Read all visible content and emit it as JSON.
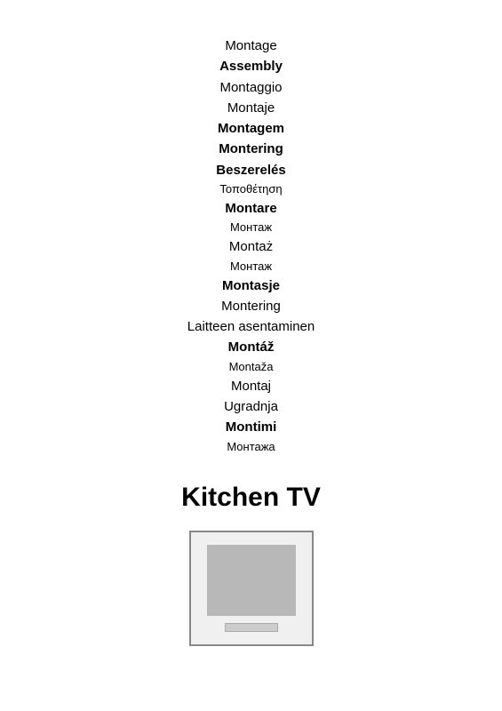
{
  "translations": [
    {
      "text": "Montage",
      "weight": "normal",
      "size": "regular"
    },
    {
      "text": "Assembly",
      "weight": "bold",
      "size": "regular"
    },
    {
      "text": "Montaggio",
      "weight": "normal",
      "size": "regular"
    },
    {
      "text": "Montaje",
      "weight": "normal",
      "size": "regular"
    },
    {
      "text": "Montagem",
      "weight": "bold",
      "size": "regular"
    },
    {
      "text": "Montering",
      "weight": "bold",
      "size": "regular"
    },
    {
      "text": "Beszerelés",
      "weight": "bold",
      "size": "regular"
    },
    {
      "text": "Τοποθέτηση",
      "weight": "normal",
      "size": "small"
    },
    {
      "text": "Montare",
      "weight": "bold",
      "size": "regular"
    },
    {
      "text": "Монтаж",
      "weight": "normal",
      "size": "small"
    },
    {
      "text": "Montaż",
      "weight": "normal",
      "size": "regular"
    },
    {
      "text": "Монтаж",
      "weight": "normal",
      "size": "small"
    },
    {
      "text": "Montasje",
      "weight": "bold",
      "size": "regular"
    },
    {
      "text": "Montering",
      "weight": "normal",
      "size": "regular"
    },
    {
      "text": "Laitteen asentaminen",
      "weight": "normal",
      "size": "regular"
    },
    {
      "text": "Montáž",
      "weight": "bold",
      "size": "regular"
    },
    {
      "text": "Montaža",
      "weight": "normal",
      "size": "small"
    },
    {
      "text": "Montaj",
      "weight": "normal",
      "size": "regular"
    },
    {
      "text": "Ugradnja",
      "weight": "normal",
      "size": "regular"
    },
    {
      "text": "Montimi",
      "weight": "bold",
      "size": "regular"
    },
    {
      "text": "Монтажа",
      "weight": "normal",
      "size": "small"
    }
  ],
  "product": {
    "title": "Kitchen TV"
  }
}
